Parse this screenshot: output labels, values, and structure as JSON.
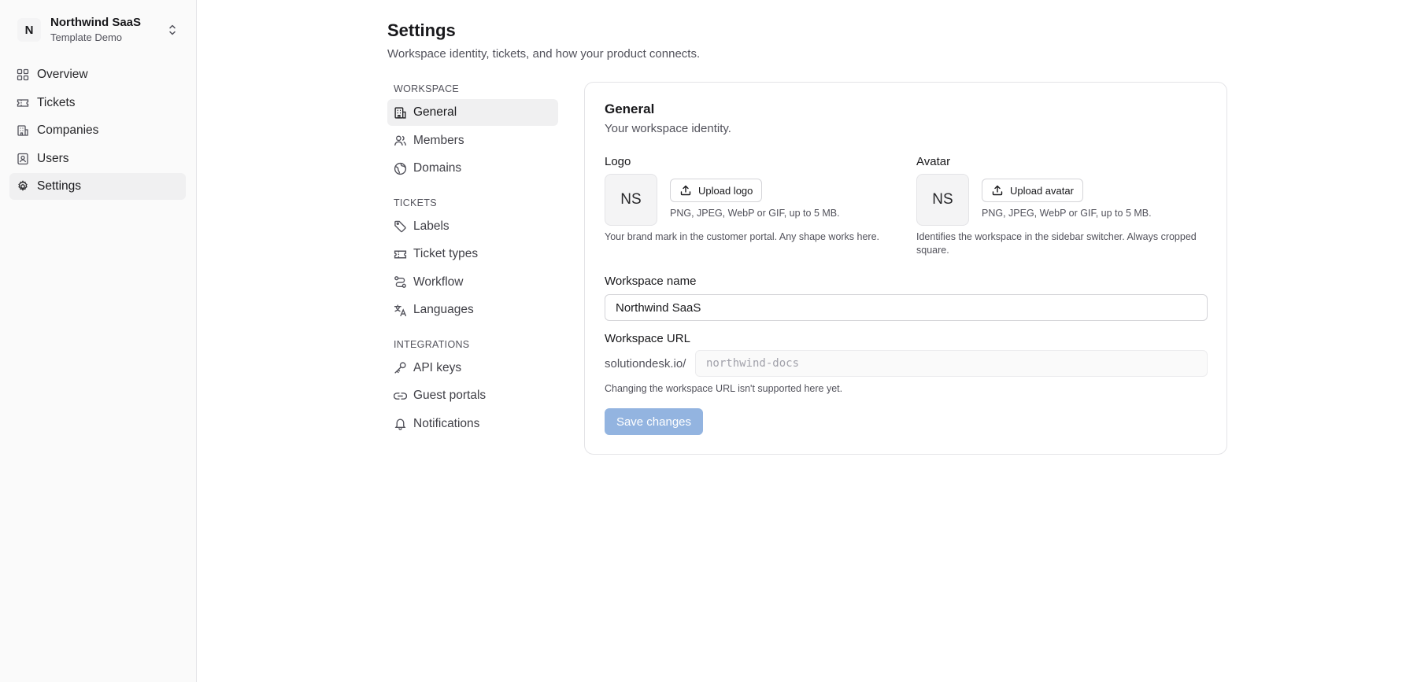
{
  "workspace": {
    "initial": "N",
    "name": "Northwind SaaS",
    "subtitle": "Template Demo"
  },
  "sidebar": {
    "items": [
      {
        "label": "Overview",
        "icon": "grid-icon"
      },
      {
        "label": "Tickets",
        "icon": "ticket-icon"
      },
      {
        "label": "Companies",
        "icon": "building-icon"
      },
      {
        "label": "Users",
        "icon": "user-square-icon"
      },
      {
        "label": "Settings",
        "icon": "gear-icon",
        "active": true
      }
    ]
  },
  "page": {
    "title": "Settings",
    "subtitle": "Workspace identity, tickets, and how your product connects."
  },
  "subnav": {
    "sections": [
      {
        "title": "WORKSPACE",
        "items": [
          {
            "label": "General",
            "icon": "building-icon",
            "active": true
          },
          {
            "label": "Members",
            "icon": "users-icon"
          },
          {
            "label": "Domains",
            "icon": "globe-icon"
          }
        ]
      },
      {
        "title": "TICKETS",
        "items": [
          {
            "label": "Labels",
            "icon": "tag-icon"
          },
          {
            "label": "Ticket types",
            "icon": "ticket-icon"
          },
          {
            "label": "Workflow",
            "icon": "route-icon"
          },
          {
            "label": "Languages",
            "icon": "languages-icon"
          }
        ]
      },
      {
        "title": "INTEGRATIONS",
        "items": [
          {
            "label": "API keys",
            "icon": "key-icon"
          },
          {
            "label": "Guest portals",
            "icon": "link-icon"
          },
          {
            "label": "Notifications",
            "icon": "bell-icon"
          }
        ]
      }
    ]
  },
  "general": {
    "title": "General",
    "subtitle": "Your workspace identity.",
    "logo": {
      "label": "Logo",
      "placeholder": "NS",
      "button": "Upload logo",
      "formats": "PNG, JPEG, WebP or GIF, up to 5 MB.",
      "help": "Your brand mark in the customer portal. Any shape works here."
    },
    "avatar": {
      "label": "Avatar",
      "placeholder": "NS",
      "button": "Upload avatar",
      "formats": "PNG, JPEG, WebP or GIF, up to 5 MB.",
      "help": "Identifies the workspace in the sidebar switcher. Always cropped square."
    },
    "name_label": "Workspace name",
    "name_value": "Northwind SaaS",
    "url_label": "Workspace URL",
    "url_prefix": "solutiondesk.io/",
    "url_value": "northwind-docs",
    "url_help": "Changing the workspace URL isn't supported here yet.",
    "save_label": "Save changes"
  },
  "colors": {
    "primary_disabled": "#93b4e0",
    "sidebar_bg": "#fafafa",
    "border": "#e4e4e7"
  }
}
